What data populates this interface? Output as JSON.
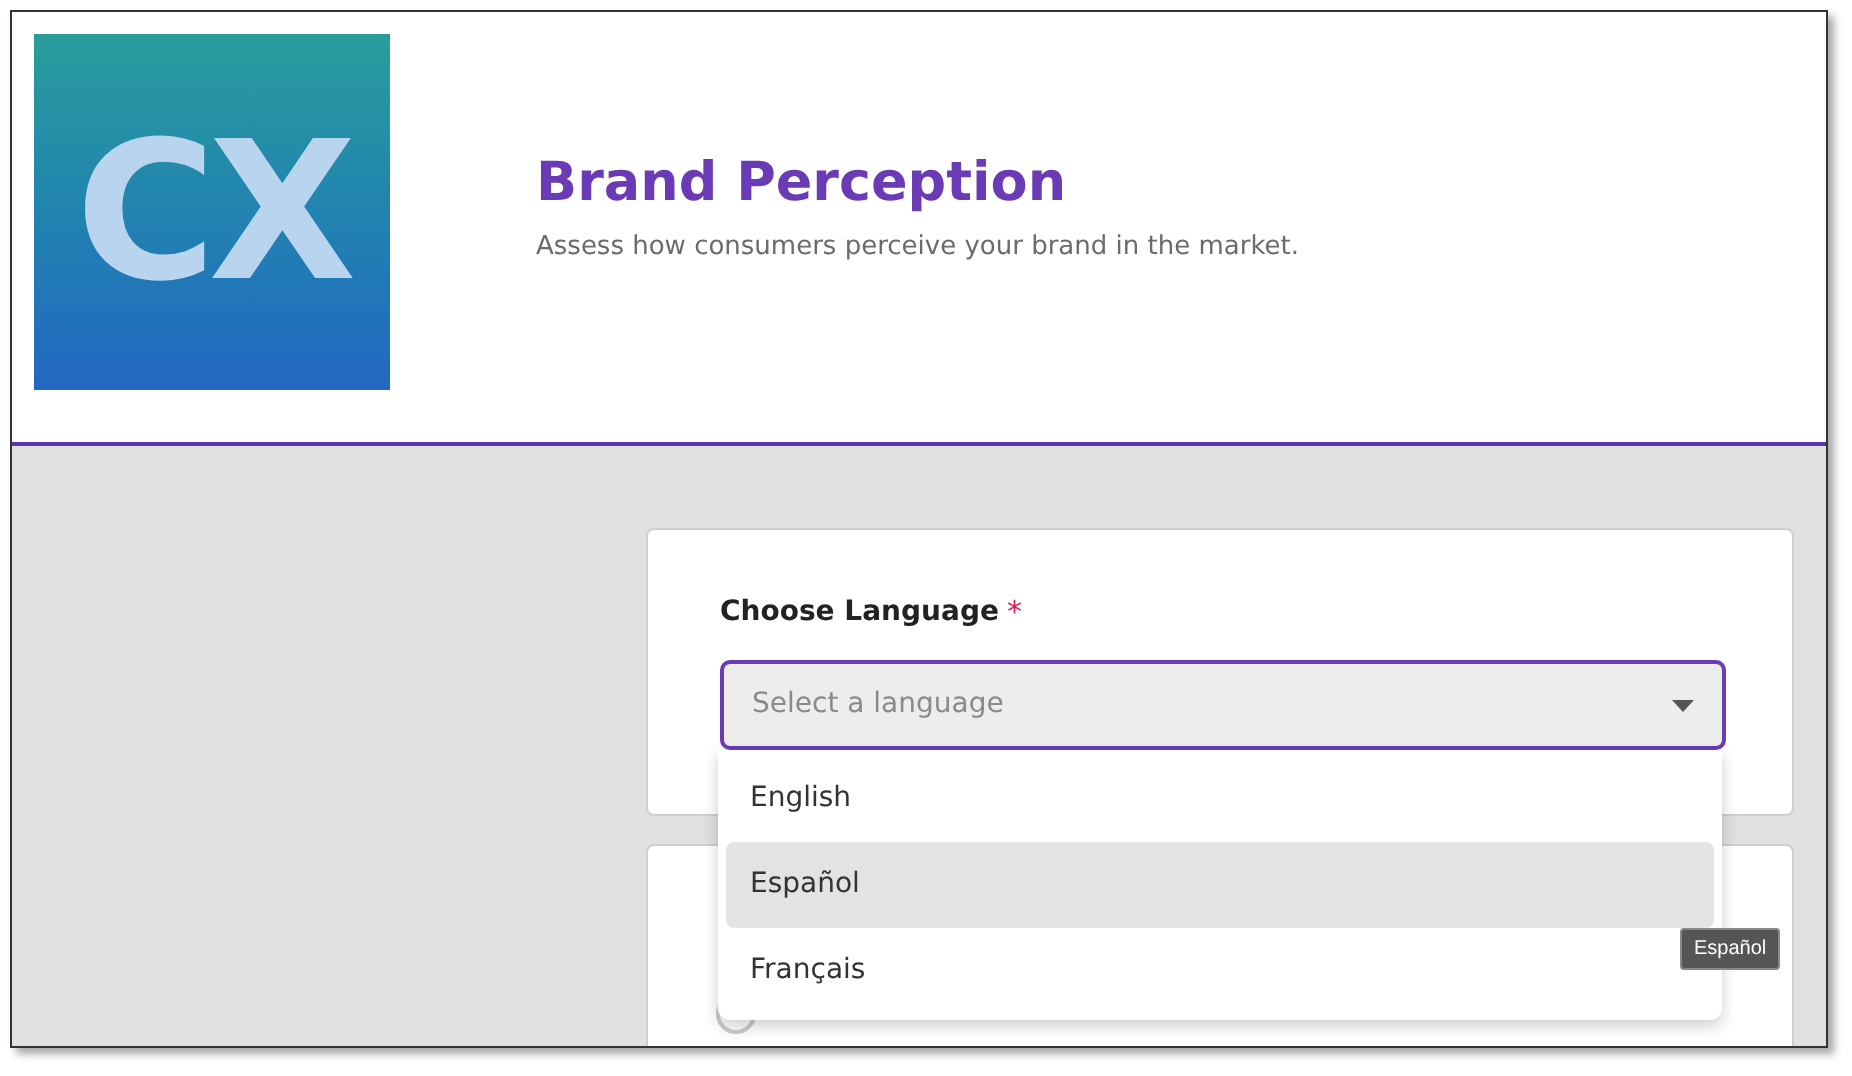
{
  "header": {
    "logo": "CX",
    "title": "Brand Perception",
    "subtitle": "Assess how consumers perceive your brand in the market."
  },
  "language_question": {
    "label": "Choose Language",
    "required_mark": "*",
    "placeholder": "Select a language",
    "expanded": true
  },
  "dropdown_options": [
    {
      "label": "English",
      "selected": false
    },
    {
      "label": "Español",
      "selected": true
    },
    {
      "label": "Français",
      "selected": false
    }
  ],
  "tooltip": "Español",
  "next_question": {
    "options": [
      {
        "checked": false
      }
    ]
  }
}
